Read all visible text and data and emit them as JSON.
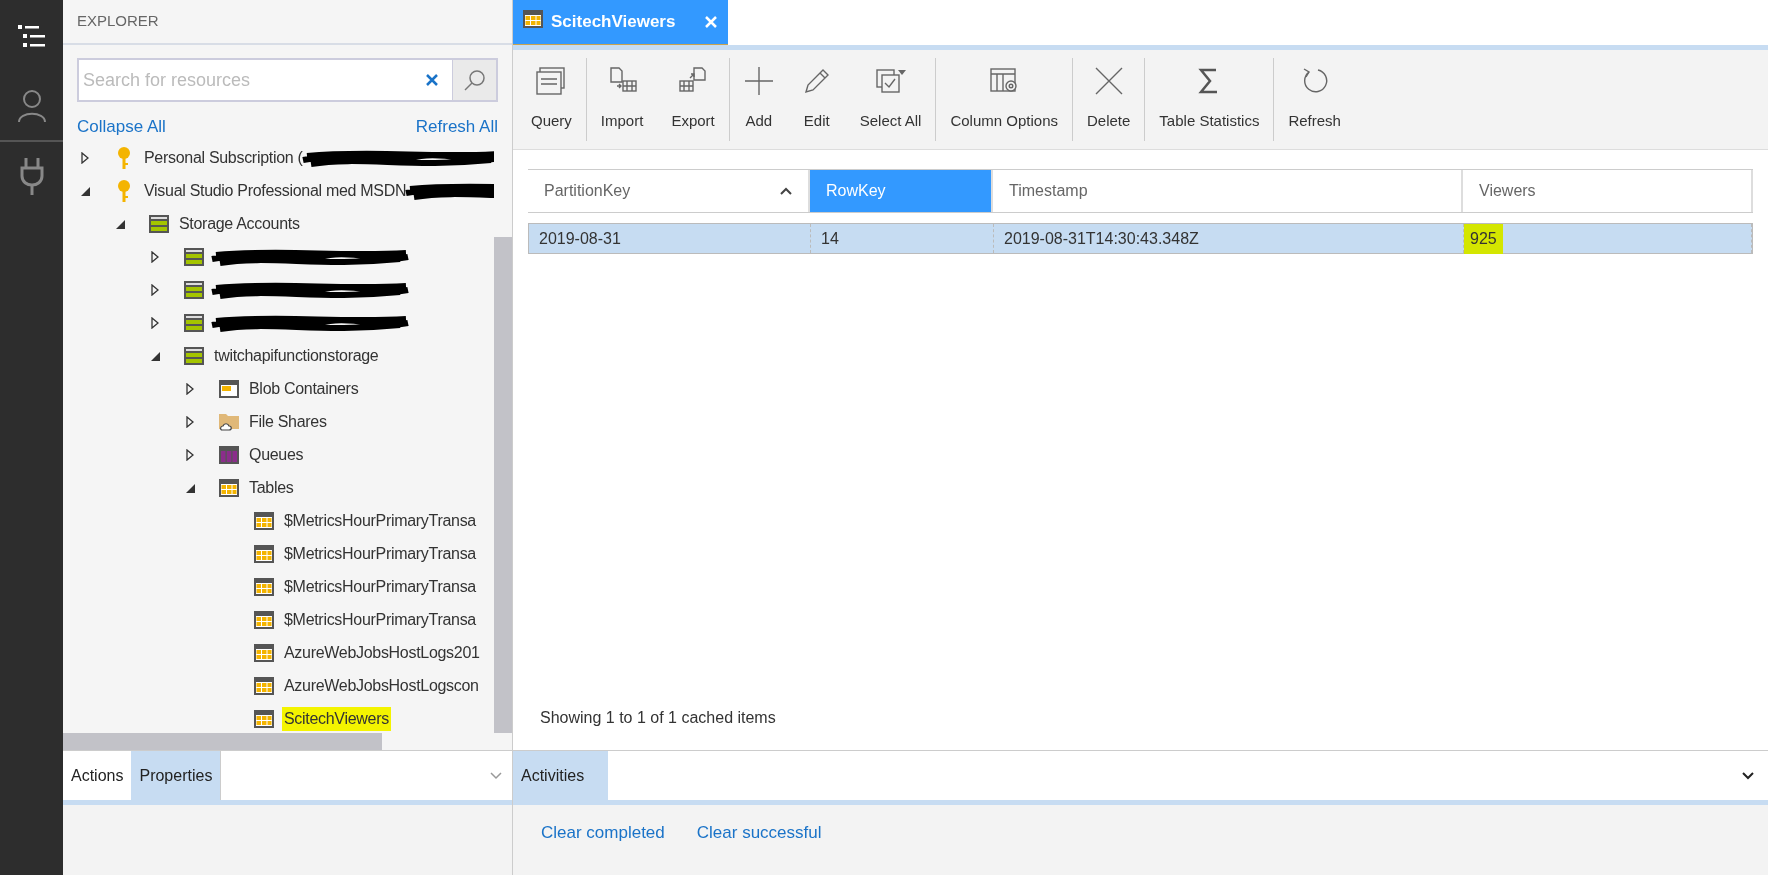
{
  "activity_bar": {
    "items": [
      {
        "kind": "explorer",
        "selected": true
      },
      {
        "kind": "account",
        "selected": false
      },
      {
        "kind": "plug",
        "selected": false
      }
    ]
  },
  "explorer": {
    "title": "EXPLORER",
    "search": {
      "placeholder": "Search for resources"
    },
    "collapse_all": "Collapse All",
    "refresh_all": "Refresh All",
    "tree": [
      {
        "label": "Personal Subscription (",
        "kind": "key",
        "expanded": false,
        "redacted": true
      },
      {
        "label": "Visual Studio Professional med MSDN",
        "kind": "key",
        "expanded": true,
        "redacted": true,
        "children": [
          {
            "label": "Storage Accounts",
            "kind": "storage",
            "expanded": true,
            "children": [
              {
                "kind": "storage",
                "expanded": false,
                "redacted": true
              },
              {
                "kind": "storage",
                "expanded": false,
                "redacted": true
              },
              {
                "kind": "storage",
                "expanded": false,
                "redacted": true
              },
              {
                "label": "twitchapifunctionstorage",
                "kind": "storage",
                "expanded": true,
                "children": [
                  {
                    "label": "Blob Containers",
                    "kind": "blob",
                    "expanded": false
                  },
                  {
                    "label": "File Shares",
                    "kind": "fileshare",
                    "expanded": false
                  },
                  {
                    "label": "Queues",
                    "kind": "queue",
                    "expanded": false
                  },
                  {
                    "label": "Tables",
                    "kind": "tables",
                    "expanded": true,
                    "children": [
                      {
                        "label": "$MetricsHourPrimaryTransa",
                        "kind": "table"
                      },
                      {
                        "label": "$MetricsHourPrimaryTransa",
                        "kind": "table"
                      },
                      {
                        "label": "$MetricsHourPrimaryTransa",
                        "kind": "table"
                      },
                      {
                        "label": "$MetricsHourPrimaryTransa",
                        "kind": "table"
                      },
                      {
                        "label": "AzureWebJobsHostLogs201",
                        "kind": "table"
                      },
                      {
                        "label": "AzureWebJobsHostLogscon",
                        "kind": "table"
                      },
                      {
                        "label": "ScitechViewers",
                        "kind": "table",
                        "highlighted": true
                      }
                    ]
                  }
                ]
              }
            ]
          }
        ]
      }
    ]
  },
  "bottom_left": {
    "tabs": [
      {
        "label": "Actions",
        "selected": false
      },
      {
        "label": "Properties",
        "selected": true
      }
    ]
  },
  "tab": {
    "label": "ScitechViewers"
  },
  "toolbar": [
    {
      "buttons": [
        {
          "label": "Query",
          "kind": "query"
        }
      ]
    },
    {
      "buttons": [
        {
          "label": "Import",
          "kind": "import"
        },
        {
          "label": "Export",
          "kind": "export"
        }
      ]
    },
    {
      "buttons": [
        {
          "label": "Add",
          "kind": "add"
        },
        {
          "label": "Edit",
          "kind": "edit"
        },
        {
          "label": "Select All",
          "kind": "selectall"
        }
      ]
    },
    {
      "buttons": [
        {
          "label": "Column Options",
          "kind": "columns"
        }
      ]
    },
    {
      "buttons": [
        {
          "label": "Delete",
          "kind": "delete"
        }
      ]
    },
    {
      "buttons": [
        {
          "label": "Table Statistics",
          "kind": "sigma"
        }
      ]
    },
    {
      "buttons": [
        {
          "label": "Refresh",
          "kind": "refresh"
        }
      ]
    }
  ],
  "table": {
    "columns": [
      {
        "label": "PartitionKey",
        "selected": false,
        "sorted": true
      },
      {
        "label": "RowKey",
        "selected": true,
        "sorted": false
      },
      {
        "label": "Timestamp",
        "selected": false,
        "sorted": false
      },
      {
        "label": "Viewers",
        "selected": false,
        "sorted": false
      }
    ],
    "rows": [
      {
        "selected": true,
        "cells": [
          {
            "text": "2019-08-31"
          },
          {
            "text": "14"
          },
          {
            "text": "2019-08-31T14:30:43.348Z"
          },
          {
            "text": "925",
            "highlighted": true
          }
        ]
      }
    ],
    "status": "Showing 1 to 1 of 1 cached items"
  },
  "activities": {
    "tabs": [
      {
        "label": "Activities",
        "selected": true
      }
    ],
    "links": [
      "Clear completed",
      "Clear successful"
    ]
  }
}
